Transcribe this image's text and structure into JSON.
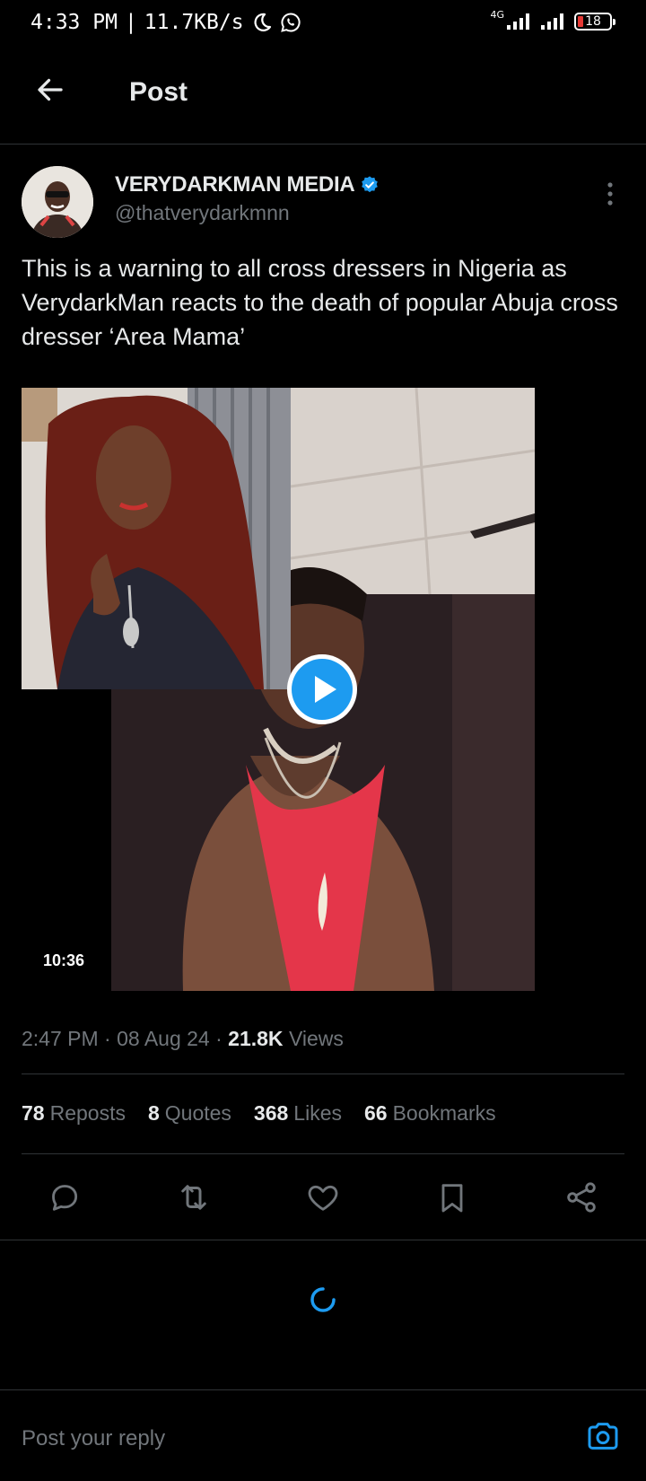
{
  "status_bar": {
    "time": "4:33 PM",
    "separator": "|",
    "speed": "11.7KB/s",
    "network": "4G",
    "battery": "18"
  },
  "header": {
    "title": "Post",
    "back_icon": "arrow-left-icon"
  },
  "author": {
    "display_name": "VERYDARKMAN MEDIA",
    "username": "@thatverydarkmnn",
    "verified_icon": "verified-badge-icon"
  },
  "post": {
    "text": "This is a warning to all cross dressers in Nigeria as VerydarkMan reacts to the death of popular Abuja cross dresser ‘Area Mama’",
    "video_duration": "10:36",
    "time": "2:47 PM",
    "date": "08 Aug 24",
    "views_count": "21.8K",
    "views_label": "Views"
  },
  "stats": {
    "reposts": {
      "count": "78",
      "label": "Reposts"
    },
    "quotes": {
      "count": "8",
      "label": "Quotes"
    },
    "likes": {
      "count": "368",
      "label": "Likes"
    },
    "bookmarks": {
      "count": "66",
      "label": "Bookmarks"
    }
  },
  "reply": {
    "placeholder": "Post your reply"
  },
  "colors": {
    "background": "#000000",
    "text": "#e7e9ea",
    "secondary": "#71767b",
    "accent": "#1d9bf0",
    "divider": "#2f3336"
  }
}
